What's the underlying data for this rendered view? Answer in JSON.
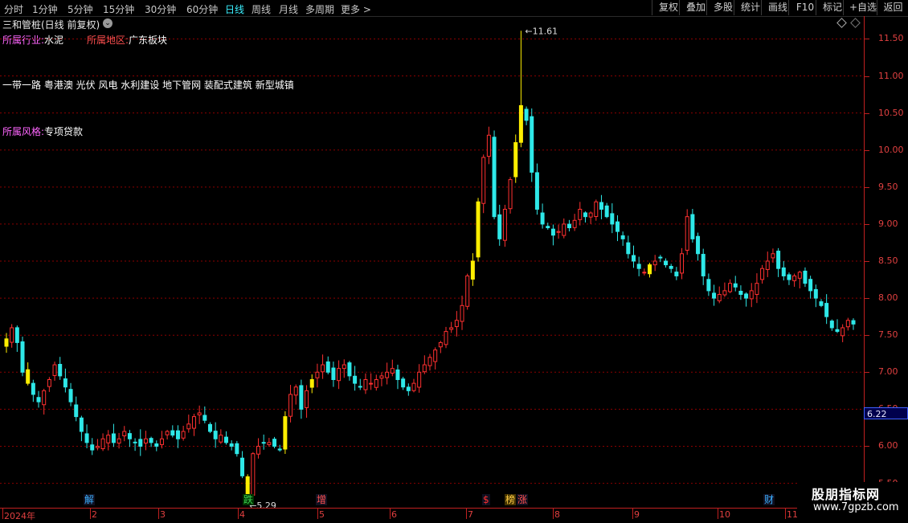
{
  "toolbar": {
    "periods": [
      "分时",
      "1分钟",
      "5分钟",
      "15分钟",
      "30分钟",
      "60分钟",
      "日线",
      "周线",
      "月线",
      "多周期",
      "更多 >"
    ],
    "active_period": "日线",
    "right_buttons": [
      "复权",
      "叠加",
      "多股",
      "统计",
      "画线",
      "F10",
      "标记",
      "+自选",
      "返回"
    ]
  },
  "stock": {
    "title": "三和管桩(日线 前复权)",
    "dropdown_glyph": "⌄"
  },
  "info": {
    "industry_label": "所属行业:",
    "industry_value": "水泥",
    "region_label": "所属地区:",
    "region_value": "广东板块",
    "concepts": "一带一路 粤港澳 光伏 风电 水利建设 地下管网 装配式建筑 新型城镇",
    "style_label": "所属风格:",
    "style_value": "专项贷款"
  },
  "price_axis": {
    "ticks": [
      "11.50",
      "11.00",
      "10.50",
      "10.00",
      "9.50",
      "9.00",
      "8.50",
      "8.00",
      "7.50",
      "7.00",
      "6.50",
      "6.00",
      "5.50"
    ],
    "current_price": "6.22"
  },
  "annotations": {
    "high_label": "11.61",
    "low_label": "5.29"
  },
  "time_axis": {
    "labels": [
      "2024年",
      "2",
      "3",
      "4",
      "5",
      "6",
      "7",
      "8",
      "9",
      "10",
      "11"
    ]
  },
  "events": [
    {
      "label": "解",
      "color": "#3ab0ff"
    },
    {
      "label": "跌",
      "color": "#3ad050"
    },
    {
      "label": "增",
      "color": "#ff5050"
    },
    {
      "label": "$",
      "color": "#ff3030"
    },
    {
      "label": "榜",
      "color": "#ffcc44"
    },
    {
      "label": "涨",
      "color": "#ff5050"
    },
    {
      "label": "财",
      "color": "#3ab0ff"
    }
  ],
  "watermark": {
    "name": "股朋指标网",
    "url": "www.7gpzb.com"
  },
  "colors": {
    "up": "#ff3030",
    "down": "#2ee8e8",
    "limit": "#ffee00",
    "grid": "#8b0000",
    "axis_text": "#e04040"
  },
  "chart_data": {
    "type": "candlestick",
    "ylim": [
      5.3,
      11.7
    ],
    "high": 11.61,
    "low": 5.29,
    "closes": [
      7.45,
      7.6,
      7.4,
      7.0,
      6.85,
      6.7,
      6.6,
      6.75,
      6.9,
      7.1,
      6.95,
      6.8,
      6.6,
      6.4,
      6.2,
      6.05,
      5.95,
      6.0,
      6.1,
      6.15,
      6.05,
      6.1,
      6.2,
      6.1,
      6.05,
      6.0,
      6.1,
      6.05,
      6.0,
      6.1,
      6.2,
      6.15,
      6.1,
      6.2,
      6.3,
      6.4,
      6.45,
      6.35,
      6.2,
      6.1,
      6.15,
      6.05,
      6.0,
      5.9,
      5.6,
      5.35,
      5.9,
      6.0,
      6.05,
      6.05,
      6.0,
      5.95,
      6.4,
      6.7,
      6.8,
      6.5,
      6.75,
      6.9,
      7.0,
      7.1,
      7.0,
      6.9,
      7.05,
      7.1,
      6.95,
      6.85,
      6.8,
      6.9,
      6.85,
      6.9,
      6.95,
      7.0,
      7.05,
      6.9,
      6.8,
      6.75,
      6.85,
      7.0,
      7.1,
      7.2,
      7.3,
      7.4,
      7.55,
      7.6,
      7.7,
      7.9,
      8.3,
      8.5,
      9.3,
      9.9,
      10.2,
      9.1,
      8.8,
      9.2,
      9.6,
      10.1,
      10.6,
      10.4,
      9.7,
      9.2,
      9.0,
      8.95,
      8.85,
      8.9,
      9.0,
      8.95,
      9.05,
      9.2,
      9.1,
      9.15,
      9.3,
      9.2,
      9.1,
      9.0,
      8.9,
      8.8,
      8.6,
      8.5,
      8.4,
      8.35,
      8.45,
      8.5,
      8.55,
      8.45,
      8.4,
      8.3,
      8.6,
      9.1,
      8.8,
      8.6,
      8.3,
      8.1,
      8.0,
      8.05,
      8.1,
      8.2,
      8.15,
      8.05,
      8.0,
      8.1,
      8.2,
      8.4,
      8.5,
      8.6,
      8.4,
      8.3,
      8.25,
      8.3,
      8.35,
      8.2,
      8.1,
      8.0,
      7.9,
      7.75,
      7.6,
      7.55,
      7.6,
      7.7,
      7.65
    ]
  }
}
